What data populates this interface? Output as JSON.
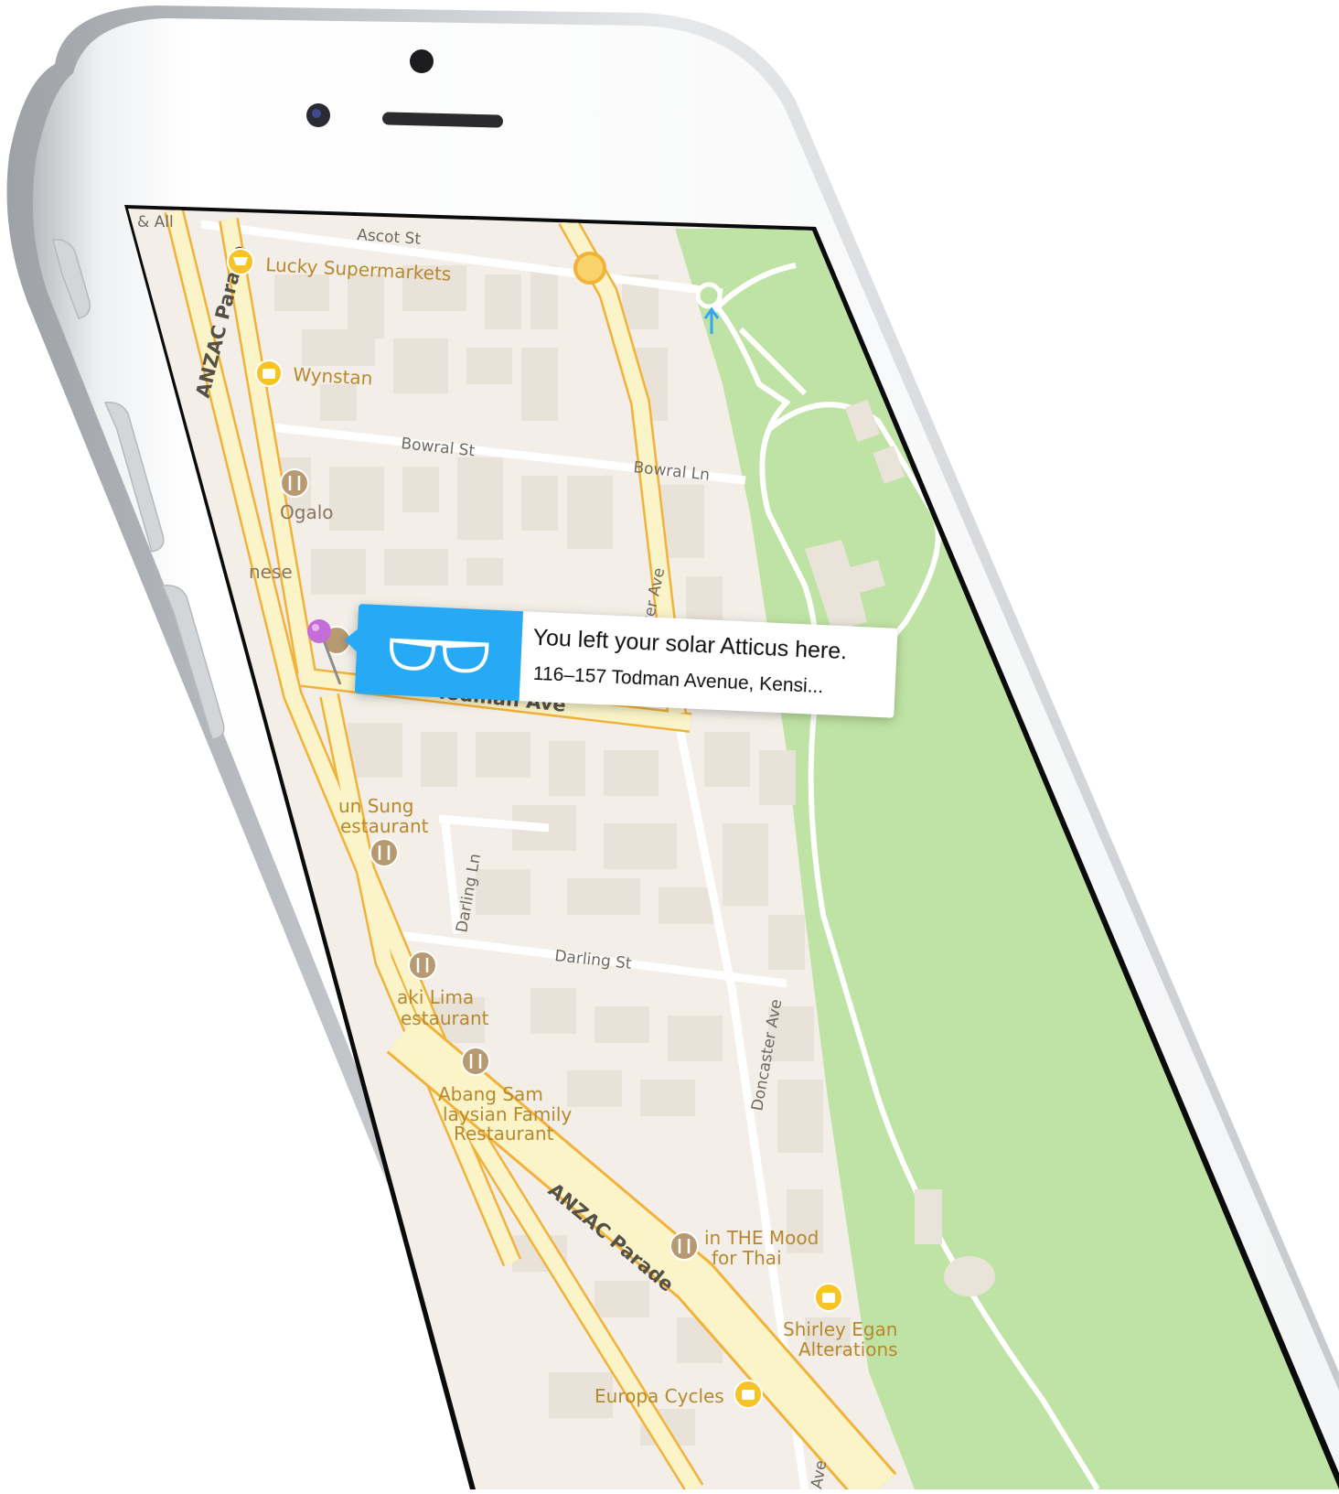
{
  "map": {
    "streets": {
      "ascot_st": "Ascot St",
      "anzac_parade_top": "ANZAC Parade",
      "bowral_st": "Bowral St",
      "bowral_ln": "Bowral Ln",
      "todman_ave": "Todman Ave",
      "darling_ln": "Darling Ln",
      "darling_st": "Darling St",
      "doncaster_ave": "Doncaster Ave",
      "anzac_parade_bottom": "ANZAC Parade",
      "corner_label": "& All",
      "doncaster_partial": "ster Ave",
      "bottom_ave": "Ave"
    },
    "places": {
      "lucky": "Lucky Supermarkets",
      "wynstan": "Wynstan",
      "ogalo": "Ogalo",
      "nese": "nese",
      "sung_line1": "un Sung",
      "sung_line2": "estaurant",
      "lima_line1": "aki Lima",
      "lima_line2": "estaurant",
      "abang_line1": "Abang Sam",
      "abang_line2": "laysian Family",
      "abang_line3": "Restaurant",
      "mood_line1": "in THE Mood",
      "mood_line2": "for Thai",
      "shirley_line1": "Shirley Egan",
      "shirley_line2": "Alterations",
      "europa": "Europa Cycles"
    }
  },
  "notification": {
    "icon": "sunglasses-icon",
    "title": "You left your solar Atticus here.",
    "address": "116–157 Todman Avenue, Kensi..."
  },
  "colors": {
    "accent": "#27aaf5",
    "park": "#bfe3a4",
    "land": "#f3efe8",
    "road_major": "#f7dc77",
    "pin": "#c46dd8"
  }
}
